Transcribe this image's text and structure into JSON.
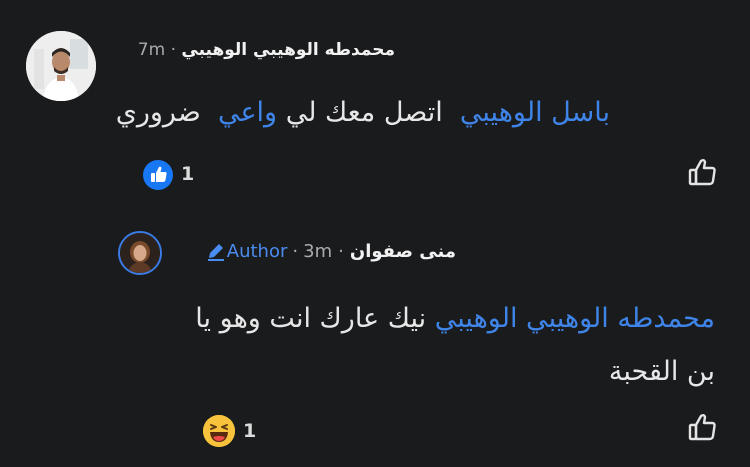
{
  "comment": {
    "author_name": "محمدطه الوهيبي الوهيبي",
    "separator": "·",
    "time": "7m",
    "mention_1": "باسل الوهيبي",
    "text_mid": "اتصل معك لي",
    "mention_2": "واعي",
    "text_end": "ضروري",
    "reaction_count": "1",
    "reaction_icon": "like-icon"
  },
  "reply": {
    "author_name": "منى صفوان",
    "separator": "·",
    "time": "3m",
    "separator2": "·",
    "badge_label": "Author",
    "mention": "محمدطه الوهيبي الوهيبي",
    "text": "نيك عارك انت وهو يا بن القحبة",
    "reaction_count": "1",
    "reaction_icon": "haha-emoji-icon"
  },
  "colors": {
    "background": "#1a1b1d",
    "mention": "#3f84e8",
    "like_blue": "#1877f2"
  }
}
